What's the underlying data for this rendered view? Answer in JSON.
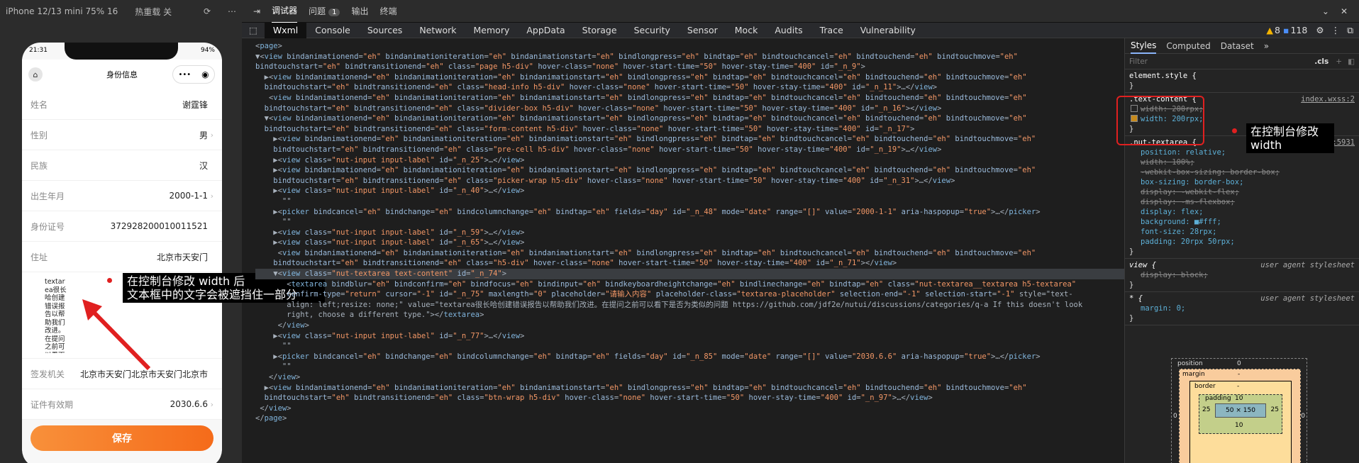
{
  "simulator": {
    "device": "iPhone 12/13 mini 75% 16",
    "hot_reload": "热重载 关",
    "status_time": "21:31",
    "battery": "94%",
    "nav_title": "身份信息",
    "capsule_dots": "•••",
    "form_rows": [
      {
        "label": "姓名",
        "value": "谢霆锋",
        "chevron": false
      },
      {
        "label": "性别",
        "value": "男",
        "chevron": true
      },
      {
        "label": "民族",
        "value": "汉",
        "chevron": false
      },
      {
        "label": "出生年月",
        "value": "2000-1-1",
        "chevron": true
      },
      {
        "label": "身份证号",
        "value": "372928200010011521",
        "chevron": false
      },
      {
        "label": "住址",
        "value": "北京市天安门",
        "chevron": false
      }
    ],
    "textarea_text": "textarea很长哈创建错误报告以帮助我们改进。在提问之前可以看下是否为类似的问题 https://github.com/jdf2e/nutui/discussions/categories/q-a If this doesn't look right, choose a different type.",
    "form_rows_after": [
      {
        "label": "签发机关",
        "value": "北京市天安门北京市天安门北京市",
        "chevron": false
      },
      {
        "label": "证件有效期",
        "value": "2030.6.6",
        "chevron": true
      }
    ],
    "save_label": "保存"
  },
  "annotations": {
    "left": "在控制台修改 width 后\n文本框中的文字会被遮挡住一部分",
    "right": "在控制台修改\nwidth"
  },
  "devtools": {
    "top_tabs": [
      "调试器",
      "问题",
      "输出",
      "终端"
    ],
    "issues_count": "1",
    "panel_tabs": [
      "Wxml",
      "Console",
      "Sources",
      "Network",
      "Memory",
      "AppData",
      "Storage",
      "Security",
      "Sensor",
      "Mock",
      "Audits",
      "Trace",
      "Vulnerability"
    ],
    "warnings": "8",
    "messages": "118",
    "wxml_lines": [
      "<page>",
      "▼<view bindanimationend=\"eh\" bindanimationiteration=\"eh\" bindanimationstart=\"eh\" bindlongpress=\"eh\" bindtap=\"eh\" bindtouchcancel=\"eh\" bindtouchend=\"eh\" bindtouchmove=\"eh\"",
      "bindtouchstart=\"eh\" bindtransitionend=\"eh\" class=\"page h5-div\" hover-class=\"none\" hover-start-time=\"50\" hover-stay-time=\"400\" id=\"_n_9\">",
      "  ▶<view bindanimationend=\"eh\" bindanimationiteration=\"eh\" bindanimationstart=\"eh\" bindlongpress=\"eh\" bindtap=\"eh\" bindtouchcancel=\"eh\" bindtouchend=\"eh\" bindtouchmove=\"eh\"",
      "  bindtouchstart=\"eh\" bindtransitionend=\"eh\" class=\"head-info h5-div\" hover-class=\"none\" hover-start-time=\"50\" hover-stay-time=\"400\" id=\"_n_11\">…</view>",
      "   <view bindanimationend=\"eh\" bindanimationiteration=\"eh\" bindanimationstart=\"eh\" bindlongpress=\"eh\" bindtap=\"eh\" bindtouchcancel=\"eh\" bindtouchend=\"eh\" bindtouchmove=\"eh\"",
      "  bindtouchstart=\"eh\" bindtransitionend=\"eh\" class=\"divider-box h5-div\" hover-class=\"none\" hover-start-time=\"50\" hover-stay-time=\"400\" id=\"_n_16\"></view>",
      "  ▼<view bindanimationend=\"eh\" bindanimationiteration=\"eh\" bindanimationstart=\"eh\" bindlongpress=\"eh\" bindtap=\"eh\" bindtouchcancel=\"eh\" bindtouchend=\"eh\" bindtouchmove=\"eh\"",
      "  bindtouchstart=\"eh\" bindtransitionend=\"eh\" class=\"form-content h5-div\" hover-class=\"none\" hover-start-time=\"50\" hover-stay-time=\"400\" id=\"_n_17\">",
      "    ▶<view bindanimationend=\"eh\" bindanimationiteration=\"eh\" bindanimationstart=\"eh\" bindlongpress=\"eh\" bindtap=\"eh\" bindtouchcancel=\"eh\" bindtouchend=\"eh\" bindtouchmove=\"eh\"",
      "    bindtouchstart=\"eh\" bindtransitionend=\"eh\" class=\"pre-cell h5-div\" hover-class=\"none\" hover-start-time=\"50\" hover-stay-time=\"400\" id=\"_n_19\">…</view>",
      "    ▶<view class=\"nut-input input-label\" id=\"_n_25\">…</view>",
      "    ▶<view bindanimationend=\"eh\" bindanimationiteration=\"eh\" bindanimationstart=\"eh\" bindlongpress=\"eh\" bindtap=\"eh\" bindtouchcancel=\"eh\" bindtouchend=\"eh\" bindtouchmove=\"eh\"",
      "    bindtouchstart=\"eh\" bindtransitionend=\"eh\" class=\"picker-wrap h5-div\" hover-class=\"none\" hover-start-time=\"50\" hover-stay-time=\"400\" id=\"_n_31\">…</view>",
      "    ▶<view class=\"nut-input input-label\" id=\"_n_40\">…</view>",
      "      \"\"",
      "    ▶<picker bindcancel=\"eh\" bindchange=\"eh\" bindcolumnchange=\"eh\" bindtap=\"eh\" fields=\"day\" id=\"_n_48\" mode=\"date\" range=\"[]\" value=\"2000-1-1\" aria-haspopup=\"true\">…</picker>",
      "      \"\"",
      "    ▶<view class=\"nut-input input-label\" id=\"_n_59\">…</view>",
      "    ▶<view class=\"nut-input input-label\" id=\"_n_65\">…</view>",
      "     <view bindanimationend=\"eh\" bindanimationiteration=\"eh\" bindanimationstart=\"eh\" bindlongpress=\"eh\" bindtap=\"eh\" bindtouchcancel=\"eh\" bindtouchend=\"eh\" bindtouchmove=\"eh\"",
      "    bindtouchstart=\"eh\" bindtransitionend=\"eh\" class=\"h5-div\" hover-class=\"none\" hover-start-time=\"50\" hover-stay-time=\"400\" id=\"_n_71\"></view>",
      "    ▼<view class=\"nut-textarea text-content\" id=\"_n_74\">",
      "       <textarea bindblur=\"eh\" bindconfirm=\"eh\" bindfocus=\"eh\" bindinput=\"eh\" bindkeyboardheightchange=\"eh\" bindlinechange=\"eh\" bindtap=\"eh\" class=\"nut-textarea__textarea h5-textarea\"",
      "       confirm-type=\"return\" cursor=\"-1\" id=\"_n_75\" maxlength=\"0\" placeholder=\"请输入内容\" placeholder-class=\"textarea-placeholder\" selection-end=\"-1\" selection-start=\"-1\" style=\"text-",
      "       align: left;resize: none;\" value=\"textarea很长哈创建错误报告以帮助我们改进。在提问之前可以看下是否为类似的问题 https://github.com/jdf2e/nutui/discussions/categories/q-a If this doesn't look",
      "       right, choose a different type.\"></textarea>",
      "     </view>",
      "    ▶<view class=\"nut-input input-label\" id=\"_n_77\">…</view>",
      "      \"\"",
      "    ▶<picker bindcancel=\"eh\" bindchange=\"eh\" bindcolumnchange=\"eh\" bindtap=\"eh\" fields=\"day\" id=\"_n_85\" mode=\"date\" range=\"[]\" value=\"2030.6.6\" aria-haspopup=\"true\">…</picker>",
      "      \"\"",
      "   </view>",
      "  ▶<view bindanimationend=\"eh\" bindanimationiteration=\"eh\" bindanimationstart=\"eh\" bindlongpress=\"eh\" bindtap=\"eh\" bindtouchcancel=\"eh\" bindtouchend=\"eh\" bindtouchmove=\"eh\"",
      "  bindtouchstart=\"eh\" bindtransitionend=\"eh\" class=\"btn-wrap h5-div\" hover-class=\"none\" hover-start-time=\"50\" hover-stay-time=\"400\" id=\"_n_97\">…</view>",
      " </view>",
      "</page>"
    ],
    "styles_tabs": [
      "Styles",
      "Computed",
      "Dataset"
    ],
    "filter_placeholder": "Filter",
    "cls_label": ".cls",
    "rules": [
      {
        "selector": "element.style {",
        "source": "",
        "ua": false,
        "props": [],
        "close": "}"
      },
      {
        "selector": ".text-content {",
        "source": "index.wxss:2",
        "ua": false,
        "props": [
          {
            "text": "width: 200rpx;",
            "struck": true,
            "checkbox": "off"
          },
          {
            "text": "width: 200rpx;",
            "struck": false,
            "checkbox": "on"
          }
        ],
        "close": "}"
      },
      {
        "selector": ".nut-textarea {",
        "source": "app.wxss:5931",
        "ua": false,
        "props": [
          {
            "text": "position: relative;",
            "struck": false
          },
          {
            "text": "width: 100%;",
            "struck": true
          },
          {
            "text": "-webkit-box-sizing: border-box;",
            "struck": true
          },
          {
            "text": "box-sizing: border-box;",
            "struck": false
          },
          {
            "text": "display: -webkit-flex;",
            "struck": true
          },
          {
            "text": "display: -ms-flexbox;",
            "struck": true
          },
          {
            "text": "display: flex;",
            "struck": false
          },
          {
            "text": "background: ■#fff;",
            "struck": false
          },
          {
            "text": "font-size: 28rpx;",
            "struck": false
          },
          {
            "text": "padding: 20rpx 50rpx;",
            "struck": false
          }
        ],
        "close": "}"
      },
      {
        "selector": "view {",
        "source": "user agent stylesheet",
        "ua": true,
        "props": [
          {
            "text": "display: block;",
            "struck": true
          }
        ],
        "close": "}"
      },
      {
        "selector": "* {",
        "source": "user agent stylesheet",
        "ua": true,
        "props": [
          {
            "text": "margin: 0;",
            "struck": false
          }
        ],
        "close": "}"
      }
    ],
    "box_model": {
      "position_label": "position",
      "position_val": "0",
      "margin_label": "margin",
      "margin_val": "-",
      "border_label": "border",
      "border_val": "-",
      "padding_label": "padding",
      "padding_top": "10",
      "padding_bottom": "10",
      "padding_left": "25",
      "padding_right": "25",
      "content": "50 × 150",
      "outer_left": "0",
      "outer_right": "0"
    }
  }
}
